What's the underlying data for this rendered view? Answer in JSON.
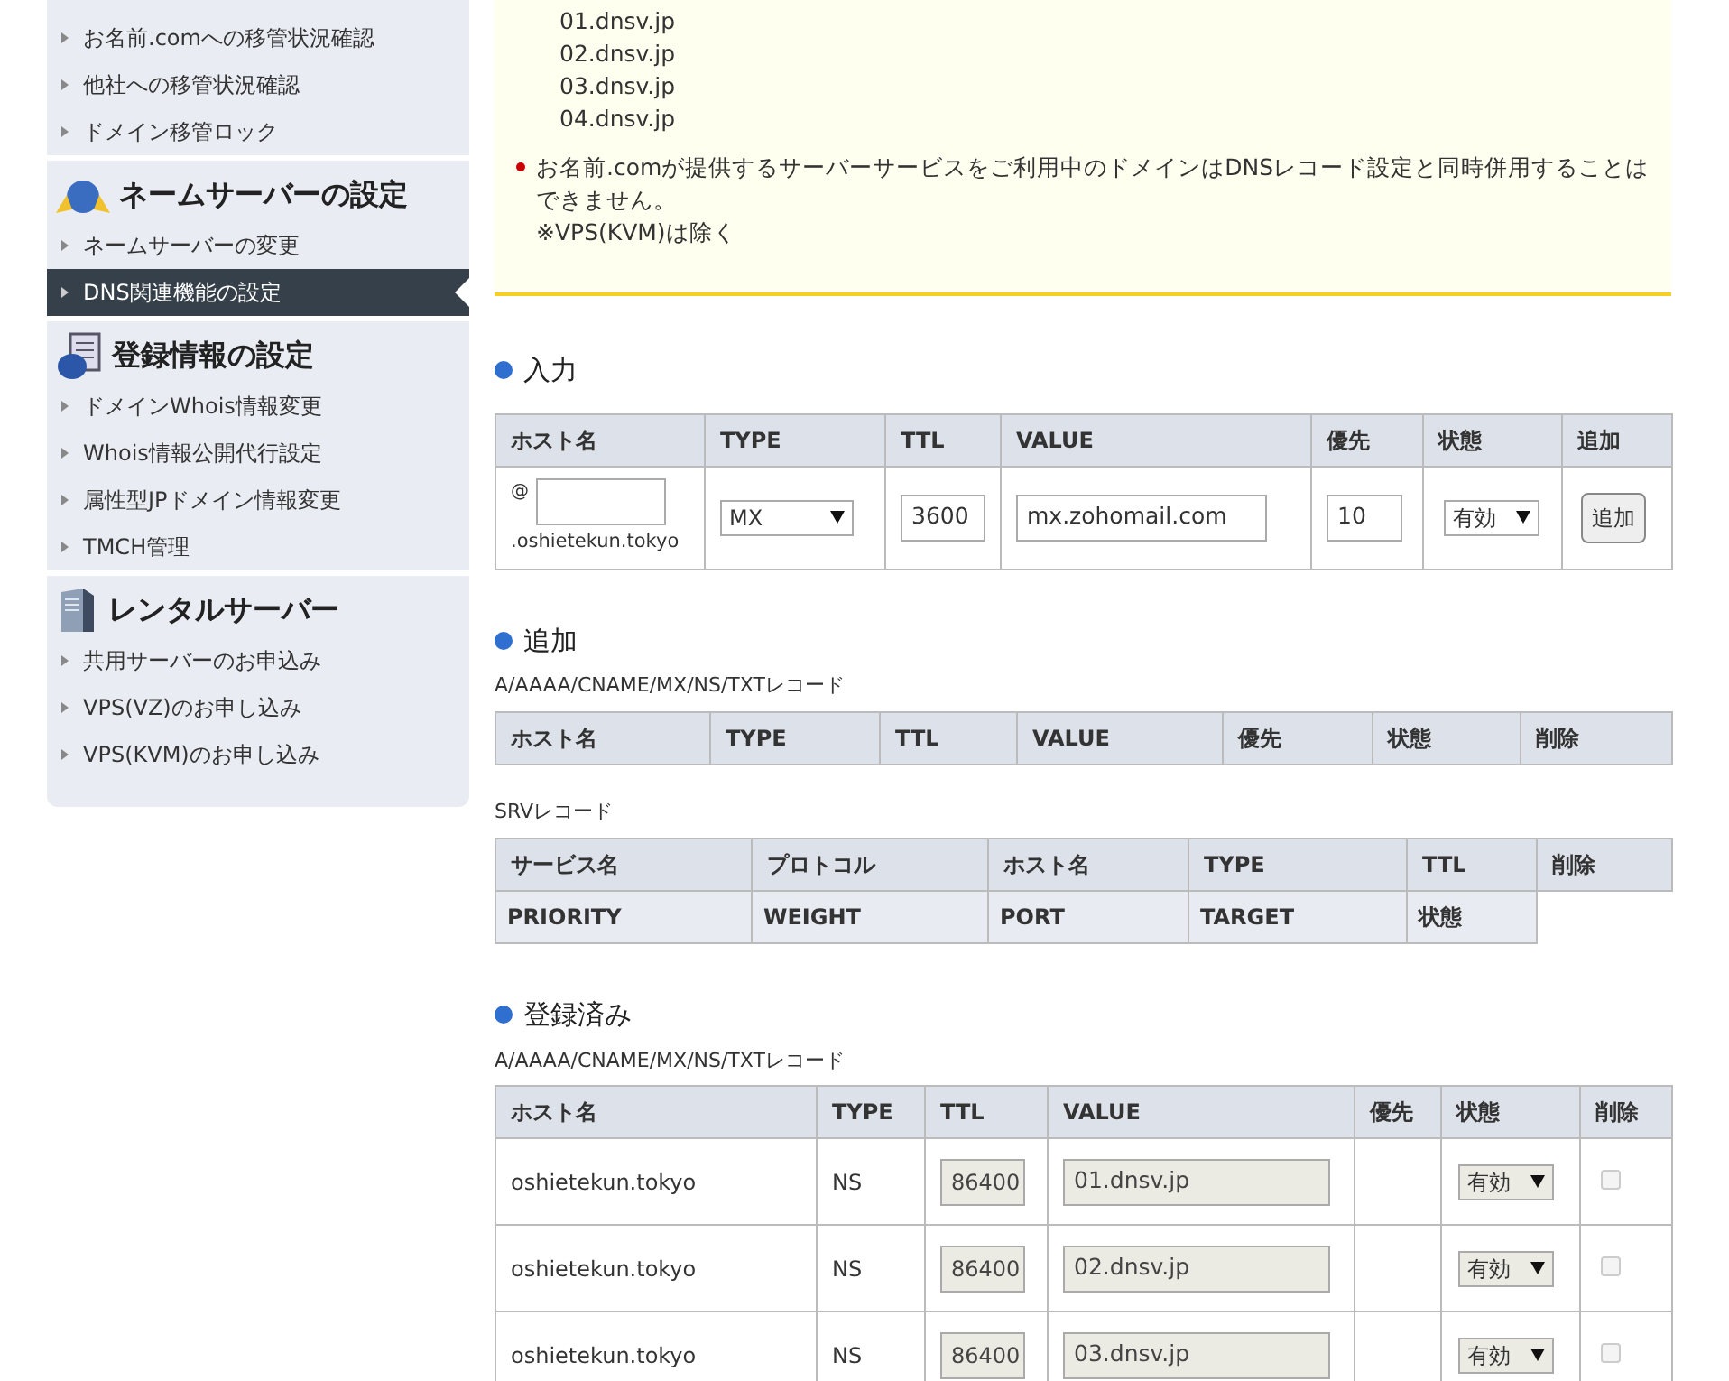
{
  "sidebar": {
    "sections": [
      {
        "items": [
          {
            "label": "お名前.comへの移管状況確認",
            "selected": false
          },
          {
            "label": "他社への移管状況確認",
            "selected": false
          },
          {
            "label": "ドメイン移管ロック",
            "selected": false
          }
        ]
      },
      {
        "title": "ネームサーバーの設定",
        "kind": "globe",
        "items": [
          {
            "label": "ネームサーバーの変更",
            "selected": false
          },
          {
            "label": "DNS関連機能の設定",
            "selected": true
          }
        ]
      },
      {
        "title": "登録情報の設定",
        "kind": "document",
        "items": [
          {
            "label": "ドメインWhois情報変更",
            "selected": false
          },
          {
            "label": "Whois情報公開代行設定",
            "selected": false
          },
          {
            "label": "属性型JPドメイン情報変更",
            "selected": false
          },
          {
            "label": "TMCH管理",
            "selected": false
          }
        ]
      },
      {
        "title": "レンタルサーバー",
        "kind": "server",
        "items": [
          {
            "label": "共用サーバーのお申込み",
            "selected": false
          },
          {
            "label": "VPS(VZ)のお申し込み",
            "selected": false
          },
          {
            "label": "VPS(KVM)のお申し込み",
            "selected": false
          }
        ]
      }
    ]
  },
  "notice": {
    "servers": [
      "01.dnsv.jp",
      "02.dnsv.jp",
      "03.dnsv.jp",
      "04.dnsv.jp"
    ],
    "bullets": [
      {
        "text": "お名前.comが提供するサーバーサービスをご利用中のドメインはDNSレコード設定と同時併用することはできません。",
        "note": "※VPS(KVM)は除く"
      }
    ]
  },
  "input": {
    "heading": "入力",
    "columns": [
      "ホスト名",
      "TYPE",
      "TTL",
      "VALUE",
      "優先",
      "状態",
      "追加"
    ],
    "host_prefix": "@",
    "host_suffix": ".oshietekun.tokyo",
    "type": "MX",
    "ttl": "3600",
    "value": "mx.zohomail.com",
    "priority": "10",
    "status": "有効",
    "button": "追加"
  },
  "add": {
    "heading": "追加",
    "caption": "A/AAAA/CNAME/MX/NS/TXTレコード",
    "columns": [
      "ホスト名",
      "TYPE",
      "TTL",
      "VALUE",
      "優先",
      "状態",
      "削除"
    ],
    "srv_caption": "SRVレコード",
    "srv_columns": [
      "サービス名",
      "プロトコル",
      "ホスト名",
      "TYPE",
      "TTL",
      "削除"
    ],
    "srv_columns_2": [
      "PRIORITY",
      "WEIGHT",
      "PORT",
      "TARGET",
      "状態"
    ]
  },
  "registered": {
    "heading": "登録済み",
    "caption": "A/AAAA/CNAME/MX/NS/TXTレコード",
    "columns": [
      "ホスト名",
      "TYPE",
      "TTL",
      "VALUE",
      "優先",
      "状態",
      "削除"
    ],
    "rows": [
      {
        "host": "oshietekun.tokyo",
        "type": "NS",
        "ttl": "86400",
        "value": "01.dnsv.jp",
        "status": "有効",
        "checked": false
      },
      {
        "host": "oshietekun.tokyo",
        "type": "NS",
        "ttl": "86400",
        "value": "02.dnsv.jp",
        "status": "有効",
        "checked": false
      },
      {
        "host": "oshietekun.tokyo",
        "type": "NS",
        "ttl": "86400",
        "value": "03.dnsv.jp",
        "status": "有効",
        "checked": false
      }
    ]
  }
}
